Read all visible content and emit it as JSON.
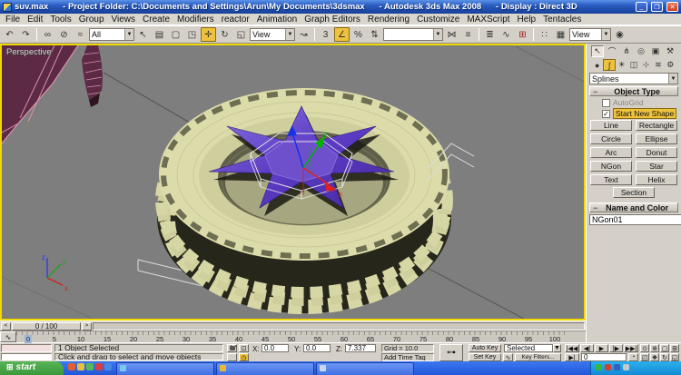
{
  "window": {
    "title": "suv.max      - Project Folder: C:\\Documents and Settings\\Arun\\My Documents\\3dsmax      - Autodesk 3ds Max 2008      - Display : Direct 3D",
    "minimize": "_",
    "restore": "❐",
    "close": "✕"
  },
  "menu": {
    "items": [
      "File",
      "Edit",
      "Tools",
      "Group",
      "Views",
      "Create",
      "Modifiers",
      "reactor",
      "Animation",
      "Graph Editors",
      "Rendering",
      "Customize",
      "MAXScript",
      "Help",
      "Tentacles"
    ]
  },
  "toolbar": {
    "selection_filter": "All",
    "ref_coord": "View",
    "render_type": "View",
    "named_selection": "",
    "icons": {
      "undo": "↶",
      "redo": "↷",
      "link": "∞",
      "unlink": "⊘",
      "bind": "≈",
      "select": "↖",
      "select_by_name": "▤",
      "rect_region": "▢",
      "window_crossing": "◳",
      "move": "✛",
      "rotate": "↻",
      "scale": "◱",
      "manipulate": "↝",
      "snap3": "3",
      "angle_snap": "∠",
      "percent_snap": "%",
      "spinner_snap": "⇅",
      "mirror": "⋈",
      "align": "≡",
      "layers": "≣",
      "curve_editor": "∿",
      "schematic": "⊞",
      "material": "∷",
      "render_setup": "▦",
      "quick_render": "◉"
    }
  },
  "viewport": {
    "label": "Perspective",
    "gizmo": {
      "x": "x",
      "y": "y"
    },
    "axis": {
      "x": "x",
      "y": "y",
      "z": "z"
    }
  },
  "command_panel": {
    "tabs": {
      "create": "↖",
      "modify": "⌒",
      "hierarchy": "⋔",
      "motion": "◎",
      "display": "▣",
      "utilities": "⚒"
    },
    "subtabs": {
      "geometry": "●",
      "shapes": "ʃ",
      "lights": "☀",
      "cameras": "◫",
      "helpers": "⊹",
      "space_warps": "≋",
      "systems": "⚙"
    },
    "class_dropdown": "Splines",
    "object_type": {
      "title": "Object Type",
      "collapse": "−",
      "autogrid": "AutoGrid",
      "check": "✓",
      "start_new_shape": "Start New Shape",
      "buttons": [
        "Line",
        "Rectangle",
        "Circle",
        "Ellipse",
        "Arc",
        "Donut",
        "NGon",
        "Star",
        "Text",
        "Helix",
        "Section"
      ]
    },
    "name_color": {
      "title": "Name and Color",
      "collapse": "−",
      "object_name": "NGon01",
      "object_color": "#5a2ca0"
    }
  },
  "timeline": {
    "slider": "0 / 100",
    "prev": "<",
    "next": ">",
    "ticks": [
      "0",
      "5",
      "10",
      "15",
      "20",
      "25",
      "30",
      "35",
      "40",
      "45",
      "50",
      "55",
      "60",
      "65",
      "70",
      "75",
      "80",
      "85",
      "90",
      "95",
      "100"
    ]
  },
  "status_bar": {
    "selection_status": "1 Object Selected",
    "prompt": "Click and drag to select and move objects",
    "x_label": "X:",
    "x_value": "0.0",
    "y_label": "Y:",
    "y_value": "0.0",
    "z_label": "Z:",
    "z_value": "7.337",
    "grid": "Grid = 10.0",
    "add_time_tag": "Add Time Tag",
    "key_icon": "⊶",
    "auto_key": "Auto Key",
    "set_key": "Set Key",
    "key_dropdown": "Selected",
    "key_filters": "Key Filters...",
    "frame": "0",
    "playback": {
      "go_start": "|◀◀",
      "prev_frame": "◀|",
      "play": "▶",
      "next_frame": "|▶",
      "go_end": "▶▶|",
      "key_mode": "▶|",
      "curve": "∿",
      "time_config": "◔",
      "clock": "◷"
    },
    "nav": {
      "zoom": "⊙",
      "zoom_all": "⊕",
      "zoom_extents": "▢",
      "zoom_extents_all": "⊞",
      "region": "◰",
      "pan": "❖",
      "arc_rotate": "↻",
      "min_max": "◱"
    }
  },
  "taskbar": {
    "start": "start"
  },
  "colors": {
    "active_tool": "#eec23c",
    "viewport_border": "#f2da00",
    "spoke": "#5b3cc4",
    "tire": "#dcdcab",
    "body": "#5c2a44"
  }
}
